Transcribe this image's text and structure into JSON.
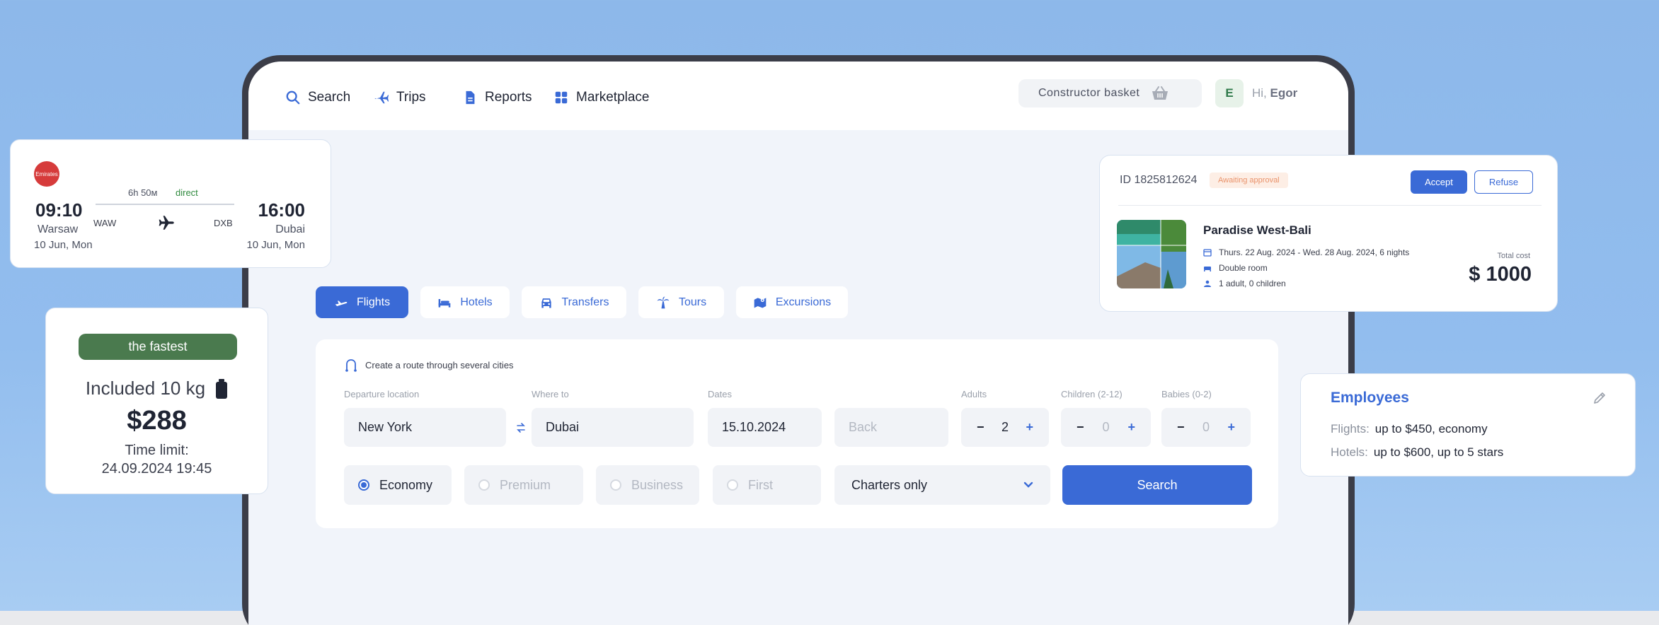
{
  "nav": {
    "search": "Search",
    "trips": "Trips",
    "reports": "Reports",
    "marketplace": "Marketplace",
    "basket": "Constructor basket",
    "avatar_letter": "E",
    "greeting_prefix": "Hi,",
    "user_name": "Egor"
  },
  "tabs": [
    {
      "label": "Flights",
      "icon": "plane-icon",
      "active": true
    },
    {
      "label": "Hotels",
      "icon": "bed-icon",
      "active": false
    },
    {
      "label": "Transfers",
      "icon": "car-icon",
      "active": false
    },
    {
      "label": "Tours",
      "icon": "palm-icon",
      "active": false
    },
    {
      "label": "Excursions",
      "icon": "map-icon",
      "active": false
    }
  ],
  "search_form": {
    "route_link": "Create a route through several cities",
    "departure_label": "Departure location",
    "departure_value": "New York",
    "where_to_label": "Where to",
    "where_to_value": "Dubai",
    "dates_label": "Dates",
    "date_value": "15.10.2024",
    "back_placeholder": "Back",
    "adults_label": "Adults",
    "adults_value": "2",
    "children_label": "Children (2-12)",
    "children_value": "0",
    "babies_label": "Babies (0-2)",
    "babies_value": "0",
    "minus": "−",
    "plus": "+",
    "classes": [
      {
        "label": "Economy",
        "selected": true
      },
      {
        "label": "Premium",
        "selected": false
      },
      {
        "label": "Business",
        "selected": false
      },
      {
        "label": "First",
        "selected": false
      }
    ],
    "charter_select": "Charters only",
    "search_button": "Search"
  },
  "flight_card": {
    "airline": "Emirates",
    "depart_time": "09:10",
    "depart_city": "Warsaw",
    "depart_date": "10 Jun, Mon",
    "arrive_time": "16:00",
    "arrive_city": "Dubai",
    "arrive_date": "10 Jun, Mon",
    "duration": "6h 50м",
    "stops": "direct",
    "from_code": "WAW",
    "to_code": "DXB"
  },
  "fastest_card": {
    "badge": "the fastest",
    "included": "Included 10 kg",
    "price": "$288",
    "time_limit_label": "Time limit:",
    "time_limit_value": "24.09.2024 19:45"
  },
  "booking_card": {
    "id": "ID 1825812624",
    "status": "Awaiting approval",
    "accept": "Accept",
    "refuse": "Refuse",
    "hotel": "Paradise West-Bali",
    "dates": "Thurs. 22 Aug. 2024 - Wed. 28 Aug. 2024, 6 nights",
    "room": "Double room",
    "guests": "1 adult, 0 children",
    "total_label": "Total cost",
    "total": "$ 1000"
  },
  "employees_card": {
    "title": "Employees",
    "flights_label": "Flights:",
    "flights_value": "up to $450, economy",
    "hotels_label": "Hotels:",
    "hotels_value": "up to $600, up to 5 stars"
  },
  "colors": {
    "accent": "#3a6ad6",
    "badge_green": "#4a7a4e",
    "status_orange": "#e9926a"
  }
}
